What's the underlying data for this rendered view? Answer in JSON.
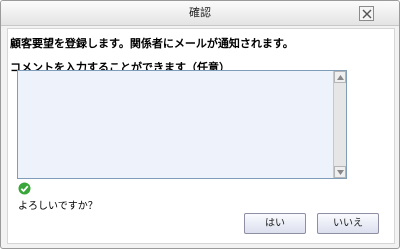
{
  "dialog": {
    "title": "確認",
    "message": "顧客要望を登録します。関係者にメールが通知されます。",
    "comment_label": "コメントを入力することができます（任意）",
    "comment_value": "",
    "confirm_text": "よろしいですか？",
    "yes_label": "はい",
    "no_label": "いいえ"
  },
  "icons": {
    "close": "close-icon",
    "check": "check-circle-icon",
    "scroll_up": "arrow-up-icon",
    "scroll_down": "arrow-down-icon"
  },
  "colors": {
    "check_green": "#3aa63a",
    "input_bg": "#eef3fb",
    "input_border": "#7f9db9"
  }
}
